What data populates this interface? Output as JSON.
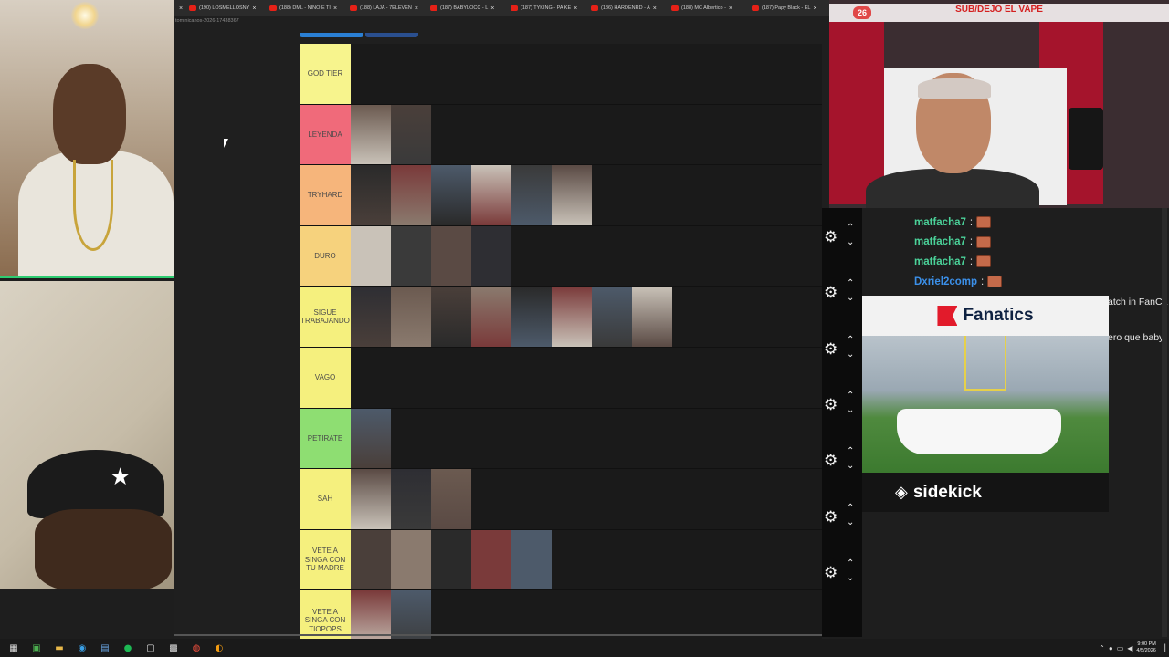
{
  "browser": {
    "tabs": [
      {
        "label": "(190) LOSMELLOSNY"
      },
      {
        "label": "(188) DML - NIÑO E TI"
      },
      {
        "label": "(188) LAJA - 7ELEVEN"
      },
      {
        "label": "(187) BABYLOCC - L"
      },
      {
        "label": "(187) TYKING - PA KE"
      },
      {
        "label": "(186) HARDENRD - A"
      },
      {
        "label": "(188) MC Albertico -"
      },
      {
        "label": "(187) Papy Black - EL"
      }
    ],
    "url": "tominicanos-2026-17438367"
  },
  "tierlist": {
    "tiers": [
      {
        "label": "GOD TIER",
        "color": "#f7f48d",
        "count": 0
      },
      {
        "label": "LEYENDA",
        "color": "#f06a7a",
        "count": 2
      },
      {
        "label": "TRYHARD",
        "color": "#f6b57b",
        "count": 6
      },
      {
        "label": "DURO",
        "color": "#f6d27d",
        "count": 4
      },
      {
        "label": "SIGUE TRABAJANDO",
        "color": "#f5f07e",
        "count": 8
      },
      {
        "label": "VAGO",
        "color": "#f5f07e",
        "count": 0
      },
      {
        "label": "PETIRATE",
        "color": "#8ede72",
        "count": 1
      },
      {
        "label": "SAH",
        "color": "#f5f07e",
        "count": 3
      },
      {
        "label": "VETE A SINGA CON TU MADRE",
        "color": "#f5f07e",
        "count": 5
      },
      {
        "label": "VETE A SINGA CON TIOPOPS",
        "color": "#f5f07e",
        "count": 2
      }
    ]
  },
  "stream": {
    "viewer_count": "26",
    "title": "SUB/DEJO EL VAPE"
  },
  "chat": {
    "messages": [
      {
        "user": "matfacha7",
        "color": "#4bd39a"
      },
      {
        "user": "matfacha7",
        "color": "#4bd39a"
      },
      {
        "user": "matfacha7",
        "color": "#4bd39a"
      },
      {
        "user": "Dxriel2comp",
        "color": "#3b8fe8"
      }
    ],
    "cutoff_1": "atch in FanCa",
    "cutoff_2": "ero que baby"
  },
  "ad": {
    "brand": "Fanatics",
    "tagline": "sidekick"
  },
  "taskbar": {
    "time": "9:00 PM",
    "date": "4/5/2026"
  }
}
